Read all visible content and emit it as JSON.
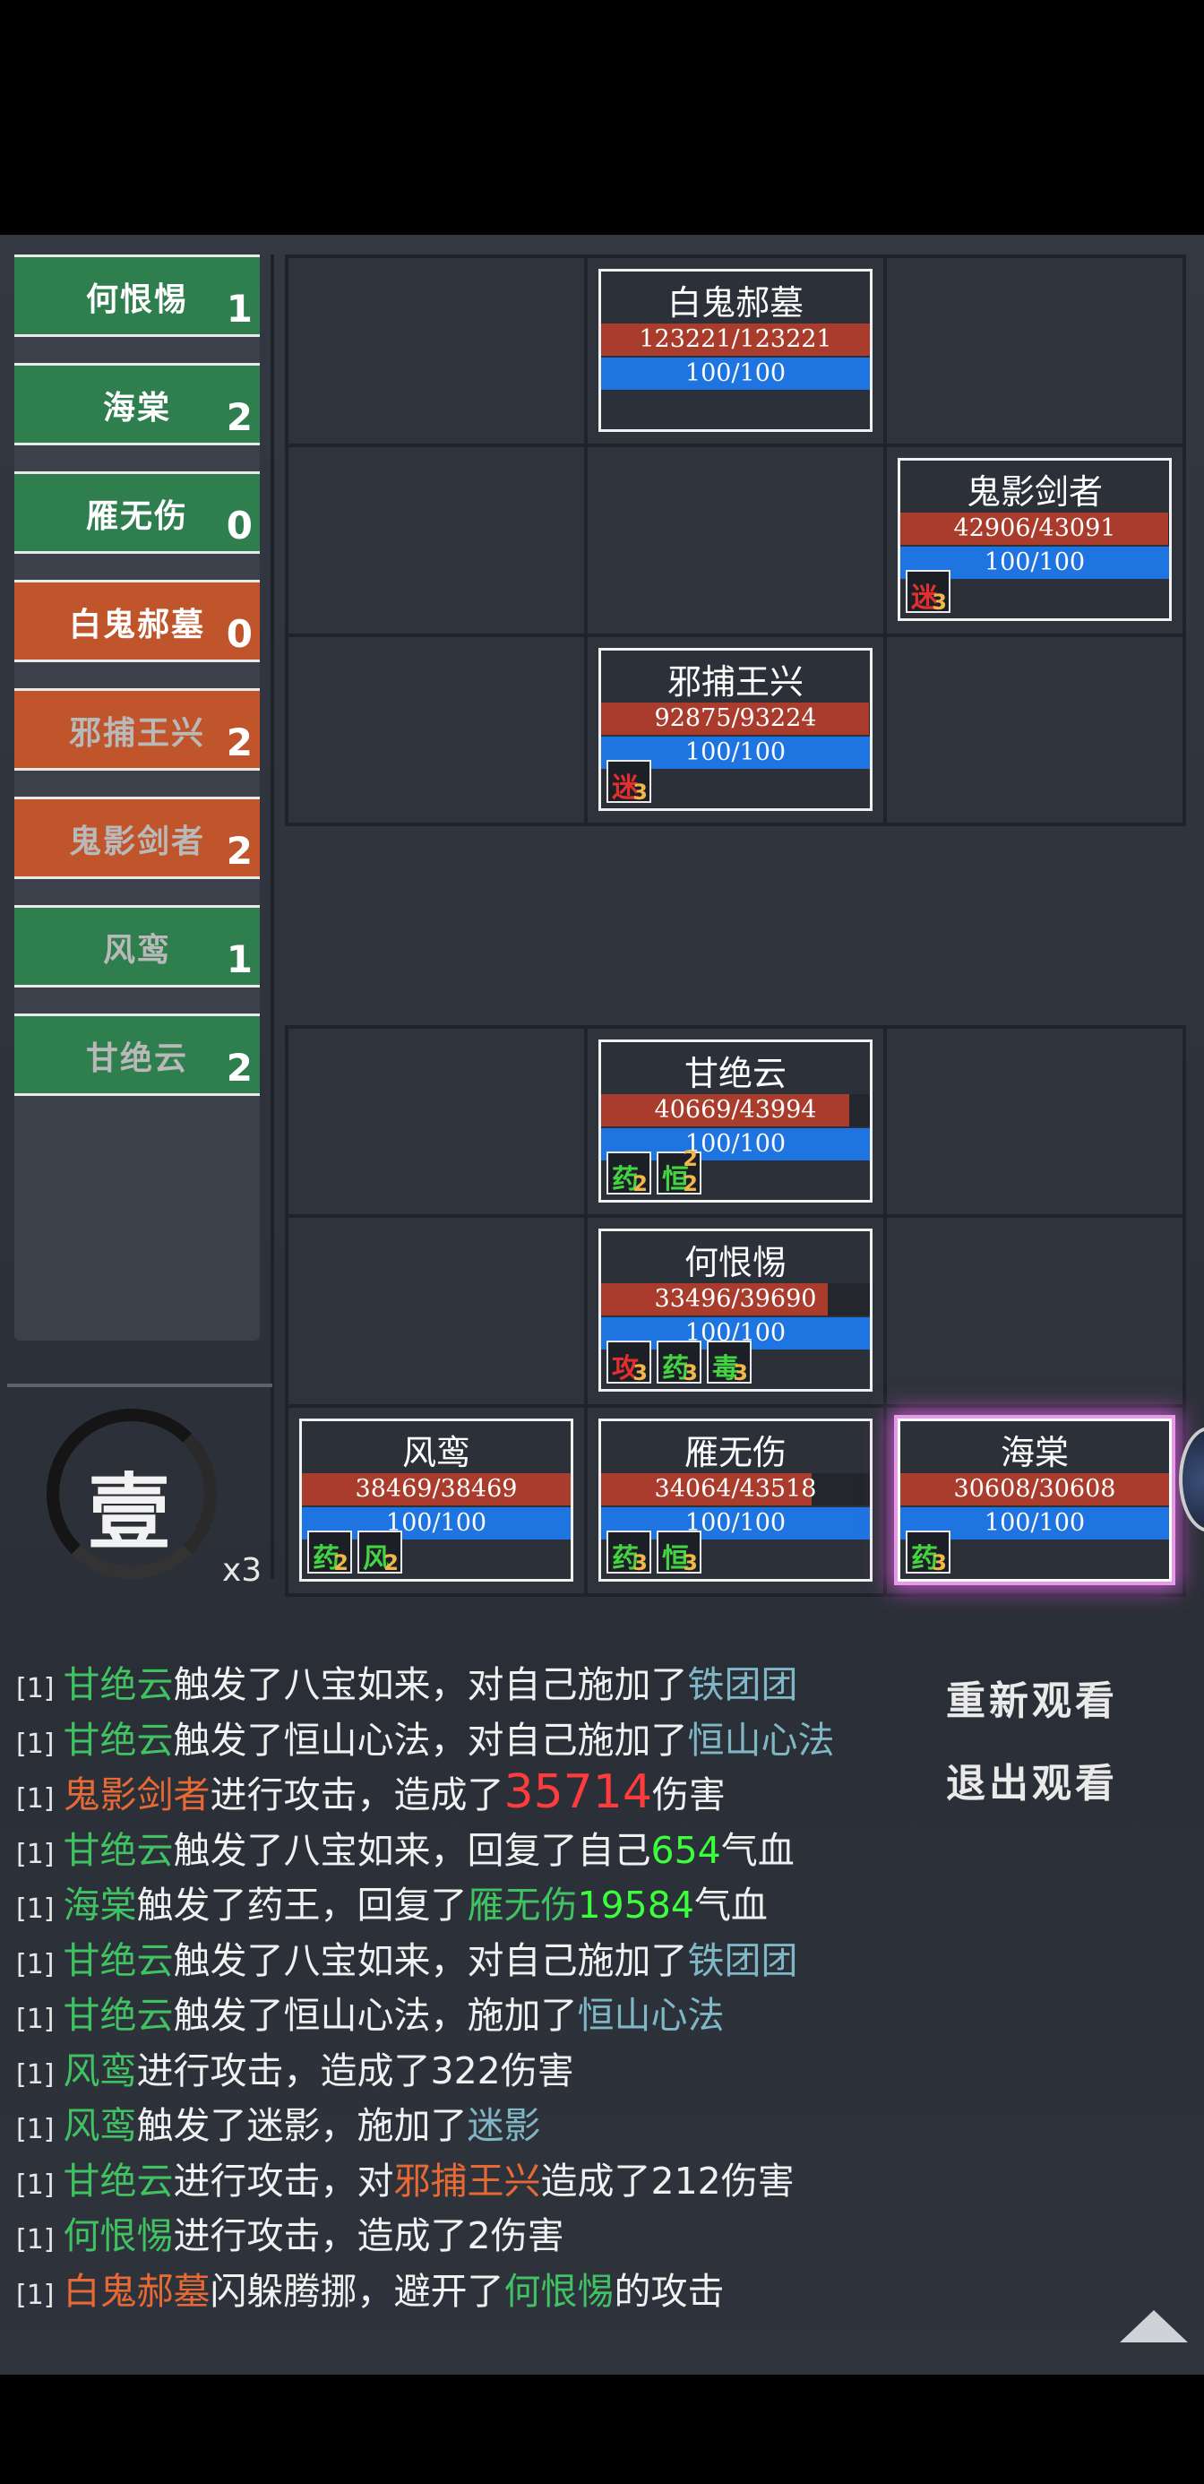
{
  "turn_order": [
    {
      "name": "何恨惕",
      "count": "1",
      "side": "ally",
      "dim": false
    },
    {
      "name": "海棠",
      "count": "2",
      "side": "ally",
      "dim": false
    },
    {
      "name": "雁无伤",
      "count": "0",
      "side": "ally",
      "dim": false
    },
    {
      "name": "白鬼郝墓",
      "count": "0",
      "side": "enemy",
      "dim": false
    },
    {
      "name": "邪捕王兴",
      "count": "2",
      "side": "enemy",
      "dim": true
    },
    {
      "name": "鬼影剑者",
      "count": "2",
      "side": "enemy",
      "dim": true
    },
    {
      "name": "风鸾",
      "count": "1",
      "side": "ally",
      "dim": true
    },
    {
      "name": "甘绝云",
      "count": "2",
      "side": "ally",
      "dim": true
    }
  ],
  "round": {
    "glyph": "壹",
    "speed": "x3"
  },
  "enemy_cards": {
    "baigui": {
      "name": "白鬼郝墓",
      "hp": "123221/123221",
      "hp_frac": 1.0,
      "mp": "100/100"
    },
    "guiying": {
      "name": "鬼影剑者",
      "hp": "42906/43091",
      "hp_frac": 0.996,
      "mp": "100/100",
      "statuses": [
        {
          "glyph": "迷",
          "turns": "3",
          "color": "red"
        }
      ]
    },
    "xiebu": {
      "name": "邪捕王兴",
      "hp": "92875/93224",
      "hp_frac": 0.996,
      "mp": "100/100",
      "statuses": [
        {
          "glyph": "迷",
          "turns": "3",
          "color": "red"
        }
      ]
    }
  },
  "ally_cards": {
    "ganjue": {
      "name": "甘绝云",
      "hp": "40669/43994",
      "hp_frac": 0.924,
      "mp": "100/100",
      "statuses": [
        {
          "glyph": "药",
          "turns": "2",
          "color": "green"
        },
        {
          "glyph": "恒",
          "turns": "2",
          "top": "2",
          "color": "green"
        }
      ]
    },
    "hehen": {
      "name": "何恨惕",
      "hp": "33496/39690",
      "hp_frac": 0.844,
      "mp": "100/100",
      "statuses": [
        {
          "glyph": "攻",
          "turns": "3",
          "color": "red"
        },
        {
          "glyph": "药",
          "turns": "3",
          "color": "green"
        },
        {
          "glyph": "毒",
          "turns": "3",
          "color": "green"
        }
      ]
    },
    "fengluan": {
      "name": "风鸾",
      "hp": "38469/38469",
      "hp_frac": 1.0,
      "mp": "100/100",
      "statuses": [
        {
          "glyph": "药",
          "turns": "2",
          "color": "green"
        },
        {
          "glyph": "风",
          "turns": "2",
          "color": "green"
        }
      ]
    },
    "yanwu": {
      "name": "雁无伤",
      "hp": "34064/43518",
      "hp_frac": 0.783,
      "mp": "100/100",
      "statuses": [
        {
          "glyph": "药",
          "turns": "3",
          "color": "green"
        },
        {
          "glyph": "恒",
          "turns": "3",
          "color": "green"
        }
      ]
    },
    "haitang": {
      "name": "海棠",
      "hp": "30608/30608",
      "hp_frac": 1.0,
      "mp": "100/100",
      "statuses": [
        {
          "glyph": "药",
          "turns": "3",
          "color": "green"
        }
      ]
    }
  },
  "log": {
    "prefix": "[1]",
    "lines": [
      [
        {
          "t": "甘绝云",
          "c": "green"
        },
        {
          "t": "触发了八宝如来，对自己施加了"
        },
        {
          "t": "铁团团",
          "c": "teal"
        }
      ],
      [
        {
          "t": "甘绝云",
          "c": "green"
        },
        {
          "t": "触发了恒山心法，对自己施加了"
        },
        {
          "t": "恒山心法",
          "c": "teal"
        }
      ],
      [
        {
          "t": "鬼影剑者",
          "c": "orange"
        },
        {
          "t": "进行攻击，造成了"
        },
        {
          "t": "35714",
          "c": "red-big"
        },
        {
          "t": "伤害"
        }
      ],
      [
        {
          "t": "甘绝云",
          "c": "green"
        },
        {
          "t": "触发了八宝如来，回复了自己"
        },
        {
          "t": "654",
          "c": "bright"
        },
        {
          "t": "气血"
        }
      ],
      [
        {
          "t": "海棠",
          "c": "green"
        },
        {
          "t": "触发了药王，回复了"
        },
        {
          "t": "雁无伤",
          "c": "green"
        },
        {
          "t": "19584",
          "c": "bright"
        },
        {
          "t": "气血"
        }
      ],
      [
        {
          "t": "甘绝云",
          "c": "green"
        },
        {
          "t": "触发了八宝如来，对自己施加了"
        },
        {
          "t": "铁团团",
          "c": "teal"
        }
      ],
      [
        {
          "t": "甘绝云",
          "c": "green"
        },
        {
          "t": "触发了恒山心法，施加了"
        },
        {
          "t": "恒山心法",
          "c": "teal"
        }
      ],
      [
        {
          "t": "风鸾",
          "c": "green"
        },
        {
          "t": "进行攻击，造成了322伤害"
        }
      ],
      [
        {
          "t": "风鸾",
          "c": "green"
        },
        {
          "t": "触发了迷影，施加了"
        },
        {
          "t": "迷影",
          "c": "teal"
        }
      ],
      [
        {
          "t": "甘绝云",
          "c": "green"
        },
        {
          "t": "进行攻击，对"
        },
        {
          "t": "邪捕王兴",
          "c": "orange"
        },
        {
          "t": "造成了212伤害"
        }
      ],
      [
        {
          "t": "何恨惕",
          "c": "green"
        },
        {
          "t": "进行攻击，造成了2伤害"
        }
      ],
      [
        {
          "t": "白鬼郝墓",
          "c": "orange"
        },
        {
          "t": "闪躲腾挪，避开了"
        },
        {
          "t": "何恨惕",
          "c": "green"
        },
        {
          "t": "的攻击"
        }
      ]
    ]
  },
  "buttons": {
    "replay": "重新观看",
    "exit": "退出观看"
  }
}
